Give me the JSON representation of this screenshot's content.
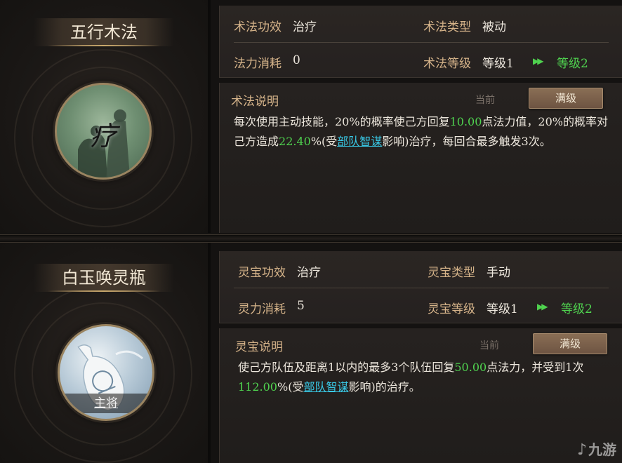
{
  "skill1": {
    "name": "五行木法",
    "avatar_char": "疗",
    "effect_label": "术法功效",
    "effect_value": "治疗",
    "type_label": "术法类型",
    "type_value": "被动",
    "cost_label": "法力消耗",
    "cost_value": "0",
    "level_label": "术法等级",
    "level_value": "等级1",
    "level_next": "等级2",
    "desc_title": "术法说明",
    "tab_current": "当前",
    "tab_max": "满级",
    "desc": {
      "p1": "每次使用主动技能，20%的概率使己方回复",
      "v1": "10.00",
      "p2": "点法力值，20%的概率对己方造成",
      "v2": "22.40",
      "p3": "%(受",
      "link": "部队智谋",
      "p4": "影响)治疗，每回合最多触发3次。"
    }
  },
  "skill2": {
    "name": "白玉唤灵瓶",
    "avatar_tag": "主将",
    "effect_label": "灵宝功效",
    "effect_value": "治疗",
    "type_label": "灵宝类型",
    "type_value": "手动",
    "cost_label": "灵力消耗",
    "cost_value": "5",
    "level_label": "灵宝等级",
    "level_value": "等级1",
    "level_next": "等级2",
    "desc_title": "灵宝说明",
    "tab_current": "当前",
    "tab_max": "满级",
    "desc": {
      "p1": "使己方队伍及距离1以内的最多3个队伍回复",
      "v1": "50.00",
      "p2": "点法力，并受到1次",
      "v2": "112.00",
      "p3": "%(受",
      "link": "部队智谋",
      "p4": "影响)的治疗。"
    }
  },
  "icons": {
    "level_arrow": "double-chevron-right-icon",
    "watermark": "9game-logo"
  },
  "watermark": {
    "text": "九游"
  },
  "colors": {
    "label": "#d6b48a",
    "value": "#ece6dc",
    "highlight": "#4fd24f",
    "link": "#39c9e6",
    "button": "#7a5f4a"
  }
}
